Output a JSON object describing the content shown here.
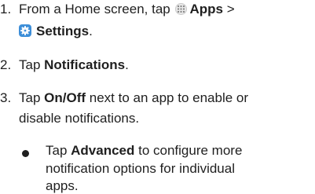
{
  "steps": [
    {
      "number": "1.",
      "line1_prefix": "From a Home screen, tap",
      "apps_label": "Apps",
      "line1_suffix": ">",
      "settings_label": "Settings",
      "line2_suffix": "."
    },
    {
      "number": "2.",
      "prefix": "Tap ",
      "bold": "Notifications",
      "suffix": "."
    },
    {
      "number": "3.",
      "prefix": "Tap ",
      "bold": "On/Off",
      "line1_suffix": " next to an app to enable or",
      "line2": "disable notifications."
    }
  ],
  "sub_bullet": {
    "prefix": "Tap ",
    "bold": "Advanced",
    "line1_suffix": " to configure more",
    "line2": "notification options for individual",
    "line3": "apps."
  },
  "icons": {
    "apps": "apps-grid-icon",
    "settings": "settings-gear-icon"
  },
  "colors": {
    "text": "#1f1f1f",
    "settings_icon_bg": "#3d8ed8"
  }
}
